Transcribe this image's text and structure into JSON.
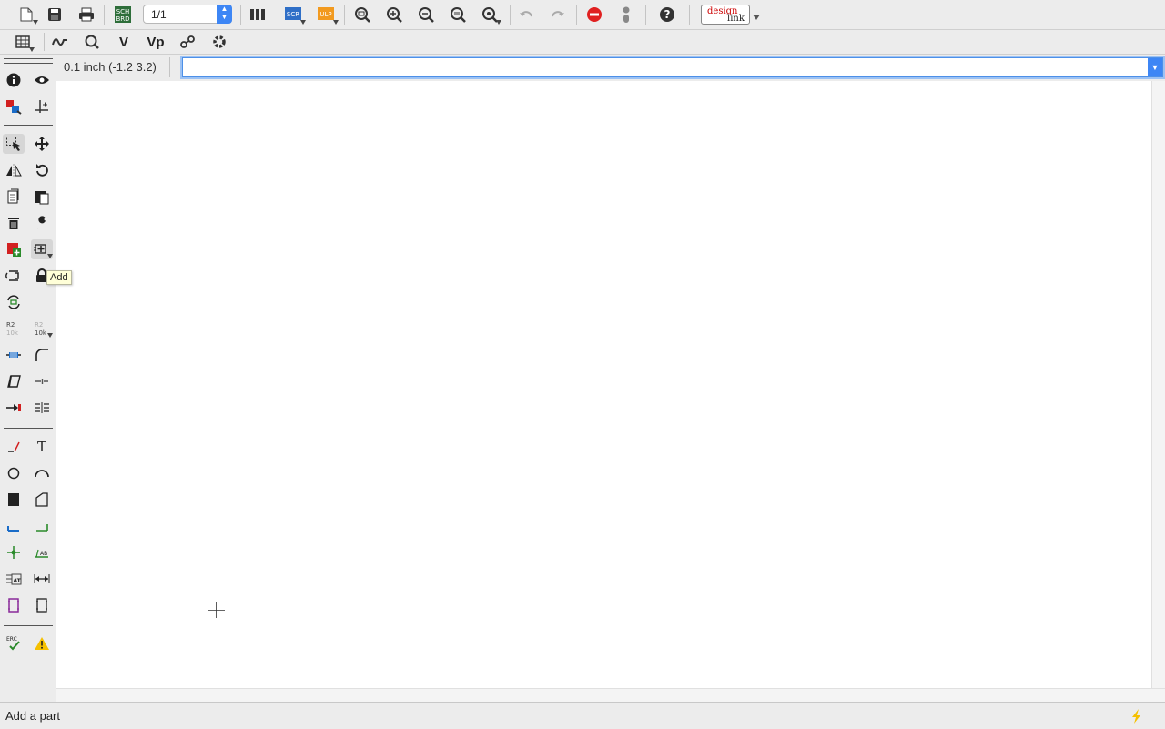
{
  "toolbar_top": {
    "page_value": "1/1",
    "logo_text_1": "design",
    "logo_text_2": "link",
    "items": [
      {
        "name": "open-icon"
      },
      {
        "name": "save-icon"
      },
      {
        "name": "print-icon"
      },
      {
        "name": "sch-brd-switch-icon"
      },
      {
        "name": "page-select"
      },
      {
        "name": "cam-processor-icon"
      },
      {
        "name": "script-icon"
      },
      {
        "name": "ulp-icon"
      },
      {
        "name": "zoom-fit-icon"
      },
      {
        "name": "zoom-in-icon"
      },
      {
        "name": "zoom-out-icon"
      },
      {
        "name": "zoom-redraw-icon"
      },
      {
        "name": "zoom-select-icon"
      },
      {
        "name": "undo-icon"
      },
      {
        "name": "redo-icon"
      },
      {
        "name": "stop-icon"
      },
      {
        "name": "go-icon"
      },
      {
        "name": "help-icon"
      },
      {
        "name": "design-link-logo"
      }
    ],
    "sch_label_1": "SCH",
    "sch_label_2": "BRD",
    "scr_label": "SCR",
    "ulp_label": "ULP"
  },
  "toolbar_second": {
    "items": [
      {
        "name": "grid-icon"
      },
      {
        "name": "simulator-icon"
      },
      {
        "name": "search-part-icon"
      },
      {
        "name": "v-icon"
      },
      {
        "name": "vp-icon"
      },
      {
        "name": "fusion-sync-icon"
      },
      {
        "name": "settings-icon"
      }
    ],
    "v_label": "V",
    "vp_label": "Vp"
  },
  "coordinate_display": "0.1 inch (-1.2 3.2)",
  "command_line": {
    "value": ""
  },
  "tooltip": "Add",
  "status_text": "Add a part",
  "left_toolbar": {
    "r2_label": "R2",
    "r2_value": "10k",
    "erc_label": "ERC",
    "text_tool_label": "T"
  },
  "colors": {
    "accent": "#3d86f5",
    "warning": "#f5c000",
    "stop": "#e02020",
    "add_red": "#d22020",
    "wire_blue": "#1a6cc8",
    "net_green": "#2a8a2a"
  }
}
